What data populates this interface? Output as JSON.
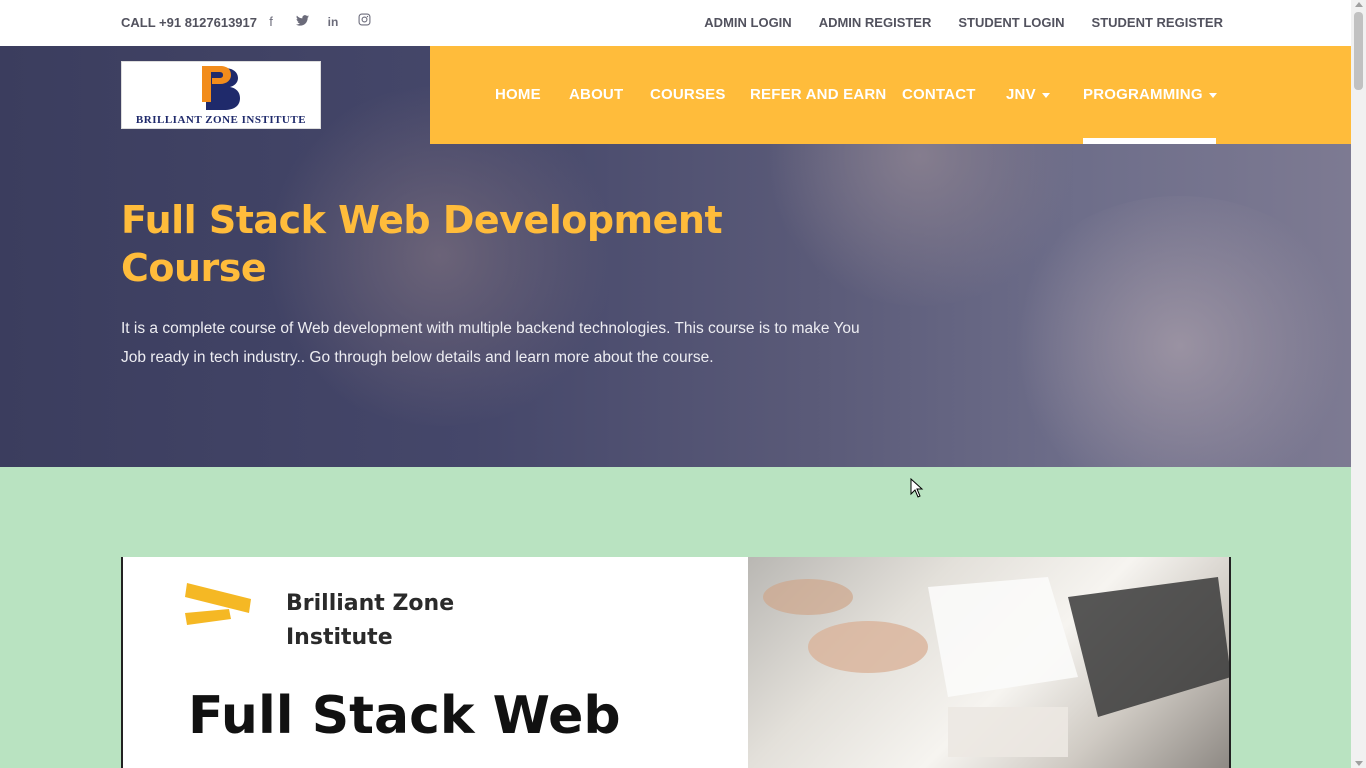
{
  "topbar": {
    "call": "CALL +91 8127613917",
    "social": [
      {
        "icon": "facebook-icon",
        "glyph": "f"
      },
      {
        "icon": "twitter-icon",
        "glyph": "t"
      },
      {
        "icon": "linkedin-icon",
        "glyph": "in"
      },
      {
        "icon": "instagram-icon",
        "glyph": "◎"
      }
    ],
    "links": [
      "ADMIN LOGIN",
      "ADMIN REGISTER",
      "STUDENT LOGIN",
      "STUDENT REGISTER"
    ]
  },
  "logo": {
    "letter": "B",
    "name": "BRILLIANT ZONE INSTITUTE"
  },
  "nav": {
    "items": [
      "HOME",
      "ABOUT",
      "COURSES",
      "REFER AND EARN",
      "CONTACT",
      "JNV",
      "PROGRAMMING"
    ],
    "active": "PROGRAMMING"
  },
  "hero": {
    "title": "Full Stack Web Development Course",
    "description": "It is a complete course of Web development with multiple backend technologies. This course is to make You Job ready in tech industry.. Go through below details and learn more about the course."
  },
  "banner": {
    "brand_line1": "Brilliant Zone",
    "brand_line2": "Institute",
    "headline": "Full Stack Web"
  },
  "colors": {
    "accent": "#ffbc3b",
    "hero_overlay": "#3b3d5e",
    "section_bg": "#b9e3c1",
    "text_dark": "#52525e"
  }
}
